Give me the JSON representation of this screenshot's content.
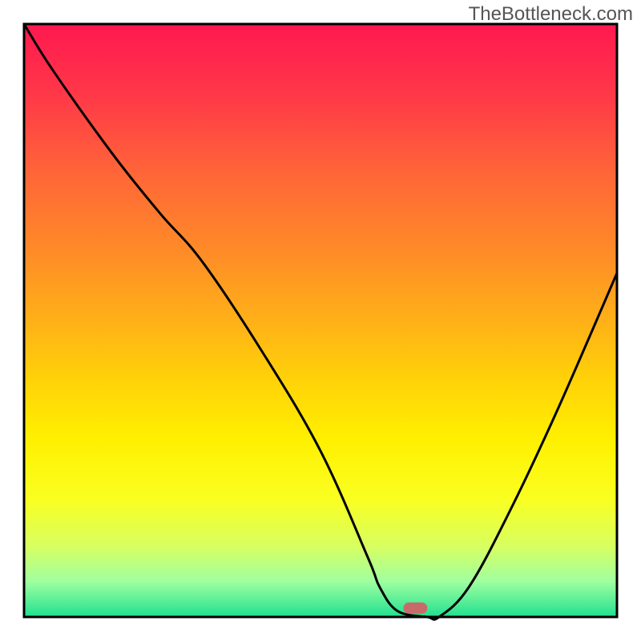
{
  "watermark": "TheBottleneck.com",
  "chart_data": {
    "type": "line",
    "title": "",
    "xlabel": "",
    "ylabel": "",
    "xlim": [
      0,
      100
    ],
    "ylim": [
      0,
      100
    ],
    "background": {
      "type": "vertical-gradient",
      "stops": [
        {
          "offset": 0,
          "color": "#ff1850"
        },
        {
          "offset": 12,
          "color": "#ff3848"
        },
        {
          "offset": 25,
          "color": "#ff6538"
        },
        {
          "offset": 38,
          "color": "#ff8a28"
        },
        {
          "offset": 50,
          "color": "#ffb018"
        },
        {
          "offset": 60,
          "color": "#ffd208"
        },
        {
          "offset": 70,
          "color": "#fff000"
        },
        {
          "offset": 80,
          "color": "#faff20"
        },
        {
          "offset": 88,
          "color": "#d8ff60"
        },
        {
          "offset": 94,
          "color": "#a0ffa0"
        },
        {
          "offset": 100,
          "color": "#20e090"
        }
      ]
    },
    "series": [
      {
        "name": "bottleneck-curve",
        "color": "#000000",
        "x": [
          0,
          5,
          15,
          23,
          30,
          40,
          50,
          58,
          60,
          63,
          68,
          70,
          75,
          82,
          90,
          100
        ],
        "y": [
          100,
          92,
          78,
          68,
          60,
          45,
          28,
          10,
          5,
          1,
          0,
          0,
          5,
          18,
          35,
          58
        ]
      }
    ],
    "marker": {
      "name": "optimal-point",
      "x": 66,
      "y": 1.5,
      "color": "#c96a6a",
      "shape": "rounded-rect"
    },
    "frame": {
      "color": "#000000",
      "width": 2
    }
  }
}
